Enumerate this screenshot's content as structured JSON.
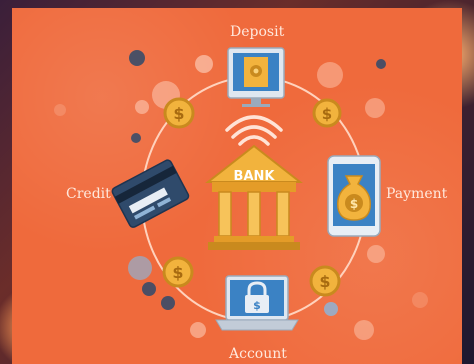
{
  "labels": {
    "deposit": "Deposit",
    "payment": "Payment",
    "account": "Account",
    "credit": "Credit",
    "bank": "BANK"
  },
  "coin_symbol": "$",
  "colors": {
    "panel": "#ef6a3c",
    "ring": "#ffd2bd",
    "gold": "#f2b33d",
    "gold_dark": "#c98a1e",
    "navy": "#2f4a6b",
    "blue": "#3b82c4",
    "white": "#f4f7fb"
  }
}
